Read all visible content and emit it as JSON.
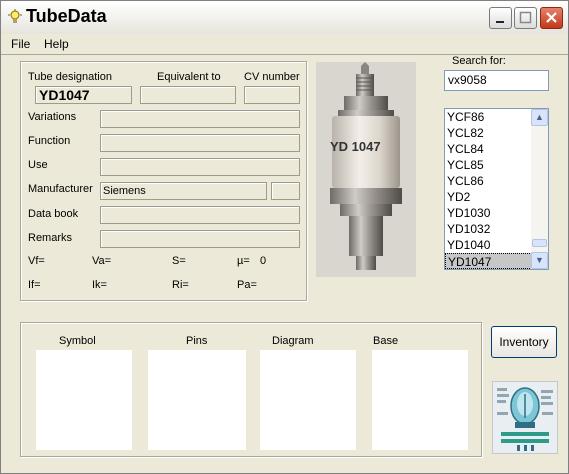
{
  "window": {
    "title": "TubeData"
  },
  "menu": {
    "file": "File",
    "help": "Help"
  },
  "tube": {
    "designation_label": "Tube designation",
    "equivalent_label": "Equivalent to",
    "cv_label": "CV number",
    "designation_value": "YD1047",
    "equivalent_value": "",
    "cv_value": "",
    "variations_label": "Variations",
    "function_label": "Function",
    "use_label": "Use",
    "manufacturer_label": "Manufacturer",
    "manufacturer_value": "Siemens",
    "databook_label": "Data book",
    "remarks_label": "Remarks",
    "vf_label": "Vf=",
    "va_label": "Va=",
    "s_label": "S=",
    "mu_label": "µ=",
    "mu_value": "0",
    "if_label": "If=",
    "ik_label": "Ik=",
    "ri_label": "Ri=",
    "pa_label": "Pa="
  },
  "photo": {
    "label": "YD 1047"
  },
  "search": {
    "label": "Search for:",
    "value": "vx9058"
  },
  "tube_list": {
    "items": [
      "YCF86",
      "YCL82",
      "YCL84",
      "YCL85",
      "YCL86",
      "YD2",
      "YD1030",
      "YD1032",
      "YD1040",
      "YD1047"
    ],
    "selected": "YD1047"
  },
  "bottom": {
    "symbol": "Symbol",
    "pins": "Pins",
    "diagram": "Diagram",
    "base": "Base"
  },
  "inventory_button": "Inventory"
}
